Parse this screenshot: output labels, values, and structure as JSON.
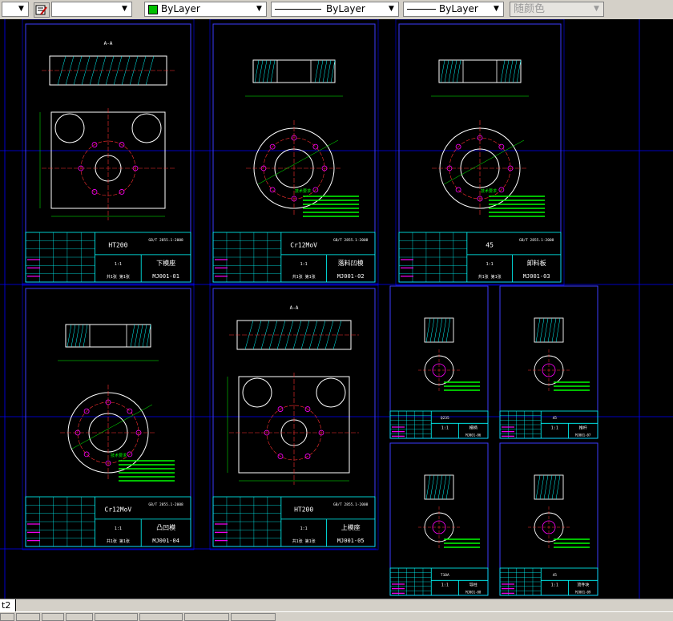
{
  "toolbar": {
    "layer_combo_value": "",
    "style_combo_value": "",
    "color_combo": {
      "value": "ByLayer",
      "swatch_color": "#00c000"
    },
    "linetype_combo": {
      "value": "ByLayer"
    },
    "lineweight_combo": {
      "value": "ByLayer"
    },
    "plotstyle_combo": {
      "value": "随颜色",
      "disabled": true
    }
  },
  "drawings": [
    {
      "material": "HT200",
      "title": "下模座",
      "code": "MJ001-01",
      "std": "GB/T 2855.1-2008",
      "scale": "1:1",
      "sheet": "共1张 第1张"
    },
    {
      "material": "Cr12MoV",
      "title": "落料凹模",
      "code": "MJ001-02",
      "std": "GB/T 2855.1-2008",
      "scale": "1:1",
      "sheet": "共1张 第1张"
    },
    {
      "material": "45",
      "title": "卸料板",
      "code": "MJ001-03",
      "std": "GB/T 2855.1-2008",
      "scale": "1:1",
      "sheet": "共1张 第1张"
    },
    {
      "material": "Cr12MoV",
      "title": "凸凹模",
      "code": "MJ001-04",
      "std": "GB/T 2855.1-2008",
      "scale": "1:1",
      "sheet": "共1张 第1张"
    },
    {
      "material": "HT200",
      "title": "上模座",
      "code": "MJ001-05",
      "std": "GB/T 2855.1-2008",
      "scale": "1:1",
      "sheet": "共1张 第1张"
    },
    {
      "material": "Q235",
      "title": "模柄",
      "code": "MJ001-06",
      "scale": "1:1"
    },
    {
      "material": "45",
      "title": "推杆",
      "code": "MJ001-07",
      "scale": "1:1"
    },
    {
      "material": "T10A",
      "title": "导柱",
      "code": "MJ001-08",
      "scale": "1:1"
    },
    {
      "material": "45",
      "title": "顶件块",
      "code": "MJ001-09",
      "scale": "1:1"
    }
  ],
  "view_labels": {
    "section": "A-A",
    "tech_req": "技术要求"
  },
  "layout_tab": {
    "label": "t2"
  },
  "colors": {
    "frame": "#0000ff",
    "sheet": "#3c3cff",
    "outline": "#ffffff",
    "dimension": "#00ff00",
    "center": "#ff3030",
    "hatch": "#00ffff",
    "hole": "#ff00ff",
    "text": "#ffffff",
    "table_line": "#00ffff",
    "table_mark": "#ff00ff",
    "note": "#00ff00"
  }
}
